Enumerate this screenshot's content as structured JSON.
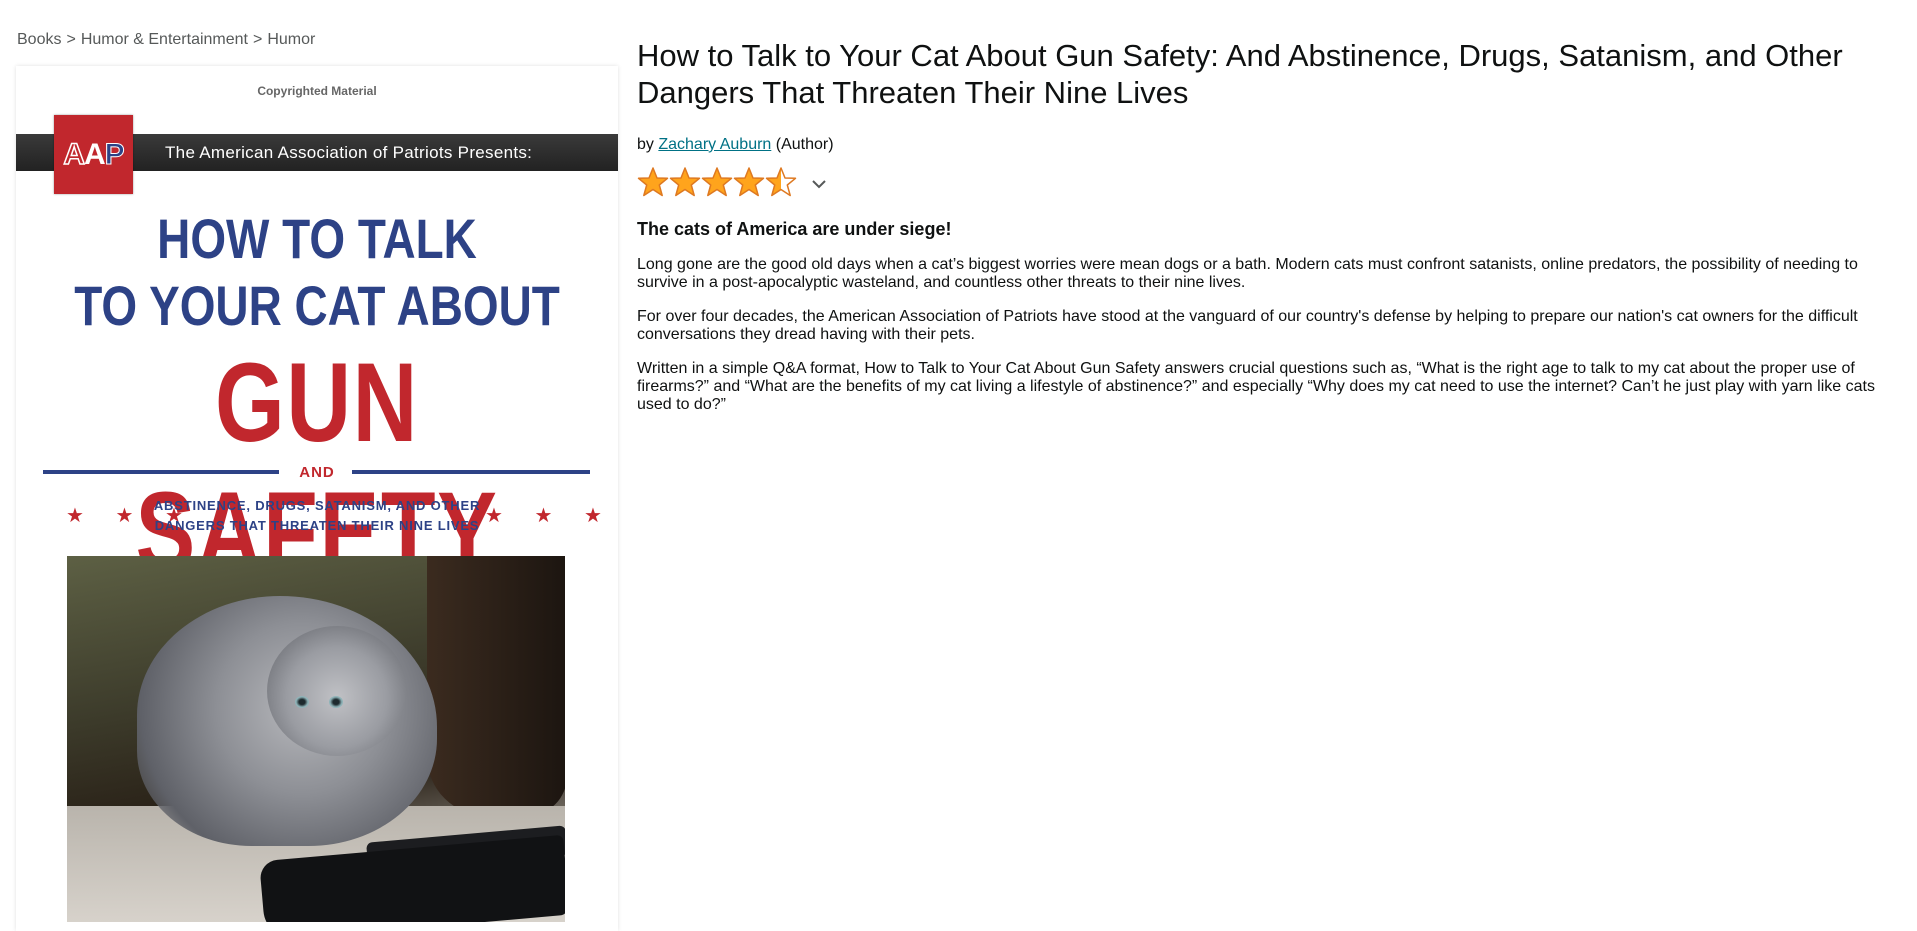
{
  "breadcrumb": {
    "items": [
      "Books",
      "Humor & Entertainment",
      "Humor"
    ],
    "separator": ">"
  },
  "cover": {
    "copyright_notice": "Copyrighted Material",
    "logo_letters": [
      "A",
      "A",
      "P"
    ],
    "banner_text": "The American Association of Patriots Presents:",
    "title_line1": "HOW TO TALK",
    "title_line2": "TO YOUR CAT ABOUT",
    "title_line3": "GUN SAFETY",
    "and_text": "AND",
    "stars_text": "★ ★ ★",
    "subtitle_line1": "ABSTINENCE, DRUGS, SATANISM, AND OTHER",
    "subtitle_line2": "DANGERS THAT THREATEN THEIR NINE LIVES"
  },
  "product": {
    "title": "How to Talk to Your Cat About Gun Safety: And Abstinence, Drugs, Satanism, and Other Dangers That Threaten Their Nine Lives",
    "by_label": "by",
    "author": "Zachary Auburn",
    "author_role": "(Author)",
    "rating": 4.5,
    "rating_max": 5,
    "star_color": "#ffa41c",
    "star_border": "#de7921",
    "link_color": "#007185",
    "tagline": "The cats of America are under siege!",
    "description": [
      "Long gone are the good old days when a cat’s biggest worries were mean dogs or a bath. Modern cats must confront satanists, online predators, the possibility of needing to survive in a post-apocalyptic wasteland, and countless other threats to their nine lives.",
      "For over four decades, the American Association of Patriots have stood at the vanguard of our country's defense by helping to prepare our nation's cat owners for the difficult conversations they dread having with their pets.",
      "Written in a simple Q&A format, How to Talk to Your Cat About Gun Safety answers crucial questions such as, “What is the right age to talk to my cat about the proper use of firearms?” and “What are the benefits of my cat living a lifestyle of abstinence?” and especially “Why does my cat need to use the internet? Can’t he just play with yarn like cats used to do?”"
    ]
  }
}
